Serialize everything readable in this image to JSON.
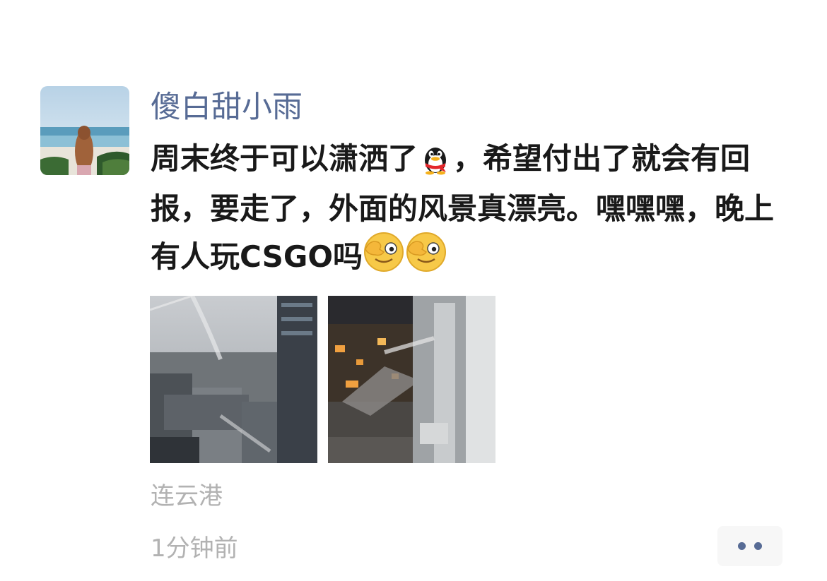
{
  "post": {
    "username": "傻白甜小雨",
    "text_segments": [
      "周末终于可以潇洒了",
      "，希望付出了就会有回报，要走了，外面的风景真漂亮。嘿嘿嘿，晚上有人玩CSGO吗"
    ],
    "inline_emojis": [
      "penguin-emoji",
      "wink-face-emoji",
      "wink-face-emoji"
    ],
    "photo_count": 2,
    "photos": [
      {
        "name": "cityscape-window-photo"
      },
      {
        "name": "night-window-photo"
      }
    ],
    "location": "连云港",
    "timestamp": "1分钟前",
    "more_icon": "more-dots-icon"
  },
  "colors": {
    "username": "#576b95",
    "body_text": "#191919",
    "meta_text": "#b2b2b2",
    "more_button_bg": "#f7f7f7",
    "more_dots": "#576b95"
  }
}
